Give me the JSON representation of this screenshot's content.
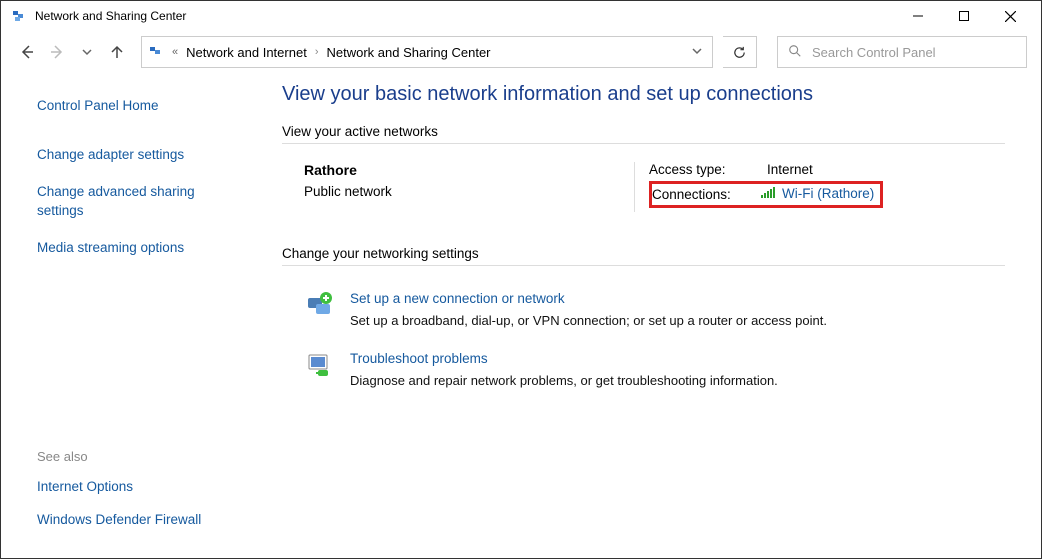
{
  "window": {
    "title": "Network and Sharing Center"
  },
  "breadcrumb": {
    "item1": "Network and Internet",
    "item2": "Network and Sharing Center"
  },
  "search": {
    "placeholder": "Search Control Panel"
  },
  "sidebar": {
    "home": "Control Panel Home",
    "adapter": "Change adapter settings",
    "advanced": "Change advanced sharing settings",
    "media": "Media streaming options",
    "see_also_label": "See also",
    "internet_options": "Internet Options",
    "firewall": "Windows Defender Firewall"
  },
  "main": {
    "heading": "View your basic network information and set up connections",
    "active_label": "View your active networks",
    "network": {
      "name": "Rathore",
      "type": "Public network",
      "access_label": "Access type:",
      "access_value": "Internet",
      "conn_label": "Connections:",
      "conn_value": "Wi-Fi (Rathore)"
    },
    "change_label": "Change your networking settings",
    "setup": {
      "title": "Set up a new connection or network",
      "desc": "Set up a broadband, dial-up, or VPN connection; or set up a router or access point."
    },
    "troubleshoot": {
      "title": "Troubleshoot problems",
      "desc": "Diagnose and repair network problems, or get troubleshooting information."
    }
  }
}
